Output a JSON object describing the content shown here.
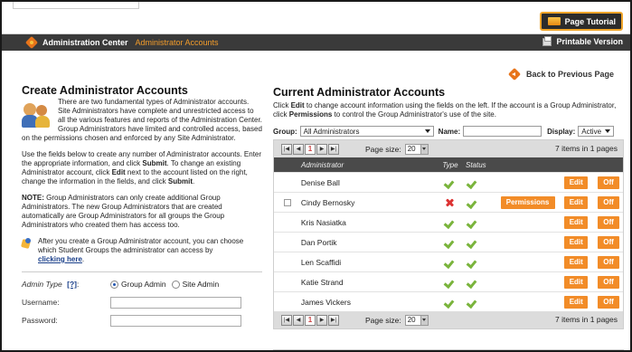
{
  "header": {
    "tutorial_label": "Page Tutorial",
    "title": "Administration Center",
    "crumb": "Administrator Accounts",
    "print_label": "Printable Version",
    "back_label": "Back to Previous Page"
  },
  "left": {
    "title": "Create Administrator Accounts",
    "intro": "There are two fundamental types of Administrator accounts. Site Administrators have complete and unrestricted access to all the various features and reports of the Administration Center. Group Administrators have limited and controlled access, based on the permissions chosen and enforced by any Site Administrator.",
    "p2_a": "Use the fields below to create any number of Administrator accounts. Enter the appropriate information, and click ",
    "p2_b": "Submit",
    "p2_c": ". To change an existing Administrator account, click ",
    "p2_d": "Edit",
    "p2_e": " next to the account listed on the right, change the information in the fields, and click ",
    "p2_f": "Submit",
    "p2_g": ".",
    "note_label": "NOTE:",
    "note": " Group Administrators can only create additional Group Administrators. The new Group Administrators that are created automatically are Group Administrators for all groups the Group Administrators who created them has access too.",
    "tip": "After you create a Group Administrator account, you can choose which Student Groups the administrator can access by",
    "tip_link": "clicking here",
    "tip_end": ".",
    "form": {
      "admin_type_label": "Admin Type",
      "help_label": "[?]",
      "help_colon": ":",
      "radio_group": "Group Admin",
      "radio_site": "Site Admin",
      "username_label": "Username:",
      "password_label": "Password:"
    }
  },
  "right": {
    "title": "Current Administrator Accounts",
    "desc_a": "Click ",
    "desc_b": "Edit",
    "desc_c": " to change account information using the fields on the left. If the account is a Group Administrator, click ",
    "desc_d": "Permissions",
    "desc_e": " to control the Group Administrator's use of the site.",
    "group_label": "Group:",
    "group_value": "All Administrators",
    "name_label": "Name:",
    "display_label": "Display:",
    "display_value": "Active",
    "pager": {
      "first": "|◀",
      "prev": "◀",
      "current": "1",
      "next": "▶",
      "last": "▶|",
      "size_label": "Page size:",
      "size_value": "20",
      "info": "7 items in 1 pages"
    },
    "columns": {
      "admin": "Administrator",
      "type": "Type",
      "status": "Status"
    },
    "edit_label": "Edit",
    "off_label": "Off",
    "permissions_label": "Permissions",
    "rows": [
      {
        "name": "Denise Ball",
        "checkbox": false,
        "type": "ok",
        "status": "ok",
        "permissions": false
      },
      {
        "name": "Cindy Bernosky",
        "checkbox": true,
        "type": "x",
        "status": "ok",
        "permissions": true
      },
      {
        "name": "Kris Nasiatka",
        "checkbox": false,
        "type": "ok",
        "status": "ok",
        "permissions": false
      },
      {
        "name": "Dan Portik",
        "checkbox": false,
        "type": "ok",
        "status": "ok",
        "permissions": false
      },
      {
        "name": "Len Scaffidi",
        "checkbox": false,
        "type": "ok",
        "status": "ok",
        "permissions": false
      },
      {
        "name": "Katie Strand",
        "checkbox": false,
        "type": "ok",
        "status": "ok",
        "permissions": false
      },
      {
        "name": "James Vickers",
        "checkbox": false,
        "type": "ok",
        "status": "ok",
        "permissions": false
      }
    ]
  },
  "colors": {
    "accent": "#f28c28",
    "nav": "#3a3a3a",
    "grid_header": "#4a4a4a",
    "link": "#1a3f8a"
  }
}
